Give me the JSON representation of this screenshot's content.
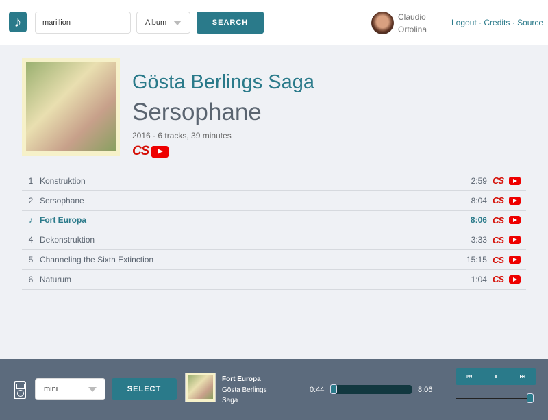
{
  "header": {
    "logo_icon": "music-note-icon",
    "search_value": "marillion",
    "search_type": "Album",
    "search_label": "SEARCH",
    "user_first": "Claudio",
    "user_last": "Ortolina",
    "links": [
      "Logout",
      "Credits",
      "Source"
    ]
  },
  "album": {
    "artist": "Gösta Berlings Saga",
    "title": "Sersophane",
    "meta": "2016 · 6 tracks, 39 minutes",
    "lastfm_glyph": "CS"
  },
  "tracks": [
    {
      "num": "1",
      "title": "Konstruktion",
      "duration": "2:59"
    },
    {
      "num": "2",
      "title": "Sersophane",
      "duration": "8:04"
    },
    {
      "num": "♪",
      "title": "Fort Europa",
      "duration": "8:06",
      "current": true
    },
    {
      "num": "4",
      "title": "Dekonstruktion",
      "duration": "3:33"
    },
    {
      "num": "5",
      "title": "Channeling the Sixth Extinction",
      "duration": "15:15"
    },
    {
      "num": "6",
      "title": "Naturum",
      "duration": "1:04"
    }
  ],
  "player": {
    "device": "mini",
    "select_label": "SELECT",
    "track": "Fort Europa",
    "artist": "Gösta Berlings Saga",
    "elapsed": "0:44",
    "total": "8:06",
    "progress": 0.0,
    "volume": 1.0,
    "controls": [
      "⏮",
      "⏸",
      "⏭"
    ]
  }
}
